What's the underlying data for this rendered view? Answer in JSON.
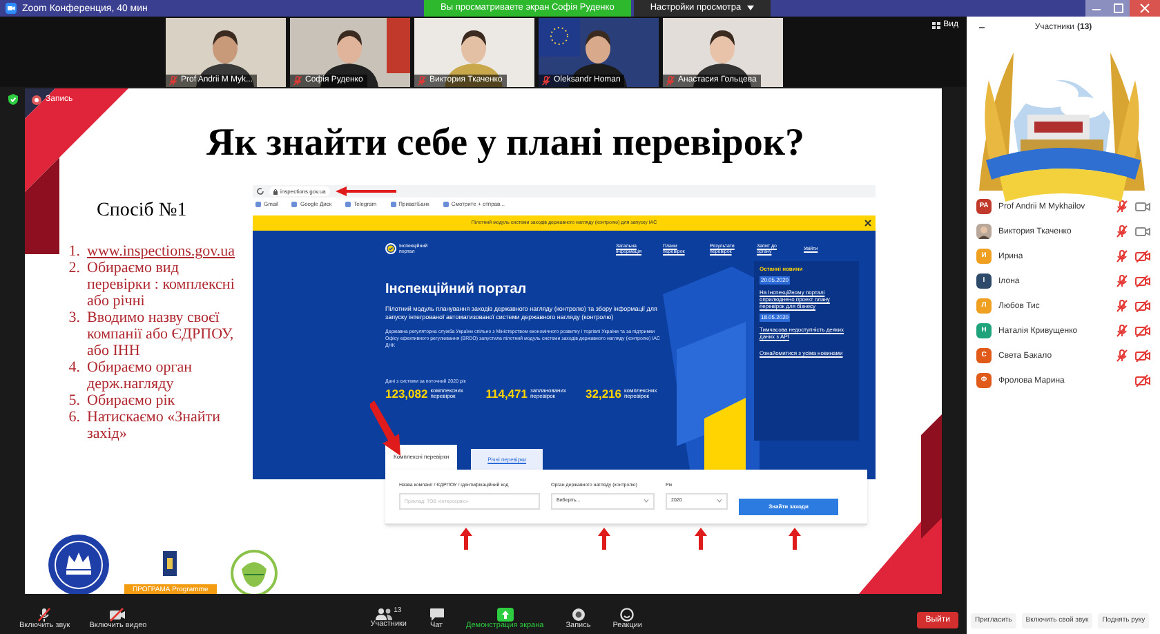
{
  "window": {
    "title": "Zoom Конференция, 40 мин"
  },
  "banner": {
    "text": "Вы просматриваете экран Софія Руденко",
    "view_options": "Настройки просмотра"
  },
  "videos": [
    {
      "name": "Prof Andrii M Myk...",
      "muted": true
    },
    {
      "name": "Софія Руденко",
      "muted": true
    },
    {
      "name": "Виктория Ткаченко",
      "muted": true
    },
    {
      "name": "Oleksandr Homan",
      "muted": true
    },
    {
      "name": "Анастасия Гольцева",
      "muted": true
    }
  ],
  "view_button": "Вид",
  "recording": "Запись",
  "slide": {
    "title": "Як знайти себе у плані перевірок?",
    "subtitle": "Спосіб №1",
    "steps": [
      {
        "number": "1.",
        "text": "www.inspections.gov.ua",
        "kind": "link"
      },
      {
        "number": "2.",
        "text": "Обираємо вид перевірки : комплексні або річні",
        "kind": "text"
      },
      {
        "number": "3.",
        "text": "Вводимо назву своєї компанії або ЄДРПОУ, або ІНН",
        "kind": "text"
      },
      {
        "number": "4.",
        "text": "Обираємо орган держ.нагляду",
        "kind": "text"
      },
      {
        "number": "5.",
        "text": "Обираємо рік",
        "kind": "text"
      },
      {
        "number": "6.",
        "text": "Натискаємо «Знайти захід»",
        "kind": "text"
      }
    ],
    "sponsor_label": "ПРОГРАМА Programme",
    "browser": {
      "url": "inspections.gov.ua",
      "bookmarks": [
        "Gmail",
        "Google Диск",
        "Telegram",
        "ПриватБанк",
        "Смотрите + отправ..."
      ],
      "notice": "Пілотний модуль системи заходів державного нагляду (контролю) для запуску ІАС",
      "portal_name": "Інспекційний портал",
      "nav": [
        "Загальна інформація",
        "Плани перевірок",
        "Результати перевірок",
        "Запит до органу",
        "Увійти"
      ],
      "heading": "Інспекційний портал",
      "lead": "Пілотний модуль планування заходів державного нагляду (контролю) та збору інформації для запуску інтегрованої автоматизованої системи державного нагляду (контролю)",
      "body": "Державна регуляторна служба України спільно з Міністерством економічного розвитку і торгівлі України та за підтримки Офісу ефективного регулювання (BRDO) запустила пілотний модуль системи заходів державного нагляду (контролю) ІАС ДНК",
      "stats_caption": "Дані з системи за поточний 2020 рік",
      "stats": [
        {
          "value": "123,082",
          "label": "комплексних перевірок"
        },
        {
          "value": "114,471",
          "label": "запланованих перевірок"
        },
        {
          "value": "32,216",
          "label": "комплексних перевірок"
        }
      ],
      "news": {
        "title": "Останні новини",
        "items": [
          {
            "date": "20.05.2020",
            "text": "На Інспекційному порталі оприлюднено проект плану перевірок для бізнесу"
          },
          {
            "date": "18.05.2020",
            "text": "Тимчасова недоступність деяких даних з АРІ"
          }
        ],
        "all_link": "Ознайомитися з усіма новинами"
      },
      "tabs": [
        {
          "label": "Комплексні перевірки",
          "selected": true
        },
        {
          "label": "Річні перевірки",
          "selected": false
        }
      ],
      "fields": [
        {
          "label": "Назва компанії / ЄДРПОУ / ідентифікаційний код",
          "placeholder": "Приклад: ТОВ «Інтерсервіс»",
          "kind": "input"
        },
        {
          "label": "Орган державного нагляду (контролю)",
          "value": "Виберіть...",
          "kind": "select"
        },
        {
          "label": "Рік",
          "value": "2020",
          "kind": "select"
        }
      ],
      "button": "Знайти заходи"
    }
  },
  "toolbar": {
    "items": [
      {
        "label": "Включить звук",
        "kind": "mic"
      },
      {
        "label": "Включить видео",
        "kind": "video"
      }
    ],
    "center": [
      {
        "label": "Участники",
        "kind": "participants",
        "count": "13"
      },
      {
        "label": "Чат",
        "kind": "chat"
      },
      {
        "label": "Демонстрация экрана",
        "kind": "share"
      },
      {
        "label": "Запись",
        "kind": "record"
      },
      {
        "label": "Реакции",
        "kind": "reactions"
      }
    ],
    "leave": "Выйти"
  },
  "participants": {
    "title": "Участники",
    "count": "(13)",
    "items": [
      {
        "initials": "PA",
        "name": "Prof Andrii M Mykhailov",
        "color": "#c0392b",
        "kind": "initials",
        "muted": true,
        "video_off": false
      },
      {
        "name": "Виктория Ткаченко",
        "muted": true,
        "video_off": false
      },
      {
        "initials": "И",
        "name": "Ирина",
        "color": "#f0a020",
        "kind": "initials",
        "muted": true,
        "video_off": true
      },
      {
        "initials": "I",
        "name": "Ілона",
        "color": "#2d4a6b",
        "kind": "initials",
        "muted": true,
        "video_off": true
      },
      {
        "initials": "Л",
        "name": "Любов Тис",
        "color": "#f0a020",
        "kind": "initials",
        "muted": true,
        "video_off": true
      },
      {
        "initials": "Н",
        "name": "Наталія Кривущенко",
        "color": "#1fa37a",
        "kind": "initials",
        "muted": true,
        "video_off": true
      },
      {
        "initials": "С",
        "name": "Света Бакало",
        "color": "#e05a1a",
        "kind": "initials",
        "muted": true,
        "video_off": true
      },
      {
        "initials": "Ф",
        "name": "Фролова Марина",
        "color": "#e05a1a",
        "kind": "initials",
        "muted": false,
        "video_off": true
      }
    ],
    "buttons": [
      "Пригласить",
      "Включить свой звук",
      "Поднять руку"
    ]
  }
}
